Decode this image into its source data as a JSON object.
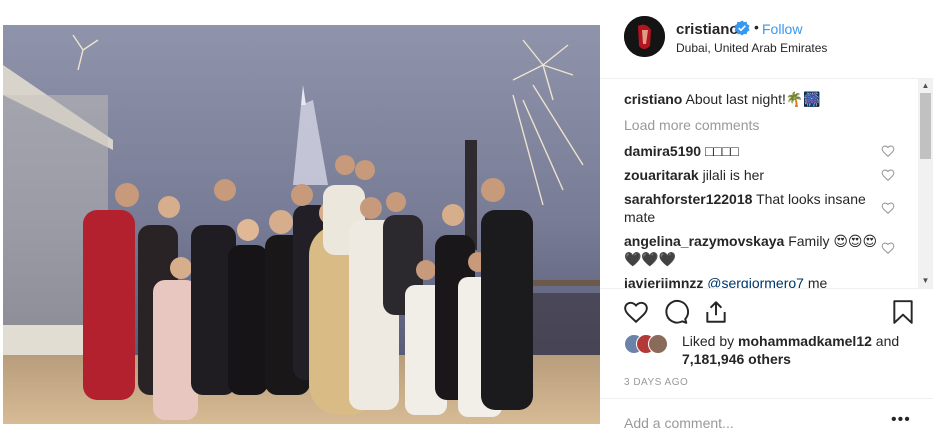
{
  "post": {
    "username": "cristiano",
    "follow_label": "Follow",
    "location": "Dubai, United Arab Emirates",
    "dot": "•"
  },
  "caption": {
    "username": "cristiano",
    "text": "About last night!🌴🎆"
  },
  "load_more_label": "Load more comments",
  "comments": [
    {
      "username": "damira5190",
      "text": "□□□□"
    },
    {
      "username": "zouaritarak",
      "text": "jilali is her"
    },
    {
      "username": "sarahforster122018",
      "text": "That looks insane mate"
    },
    {
      "username": "angelina_razymovskaya",
      "text": "Family 😍😍😍 🖤🖤🖤"
    },
    {
      "username": "javierjimnzz",
      "mention": "@sergiormero7",
      "text": "me"
    }
  ],
  "likes": {
    "prefix": "Liked by",
    "user": "mohammadkamel12",
    "middle": "and",
    "count": "7,181,946 others"
  },
  "timestamp": "3 DAYS AGO",
  "add_comment_placeholder": "Add a comment...",
  "more_label": "•••",
  "icons": {
    "verified": "verified-badge-icon",
    "like": "heart-icon",
    "comment": "comment-icon",
    "share": "share-icon",
    "save": "bookmark-icon"
  },
  "colors": {
    "link_blue": "#3897f0",
    "text": "#262626",
    "muted": "#999999"
  }
}
